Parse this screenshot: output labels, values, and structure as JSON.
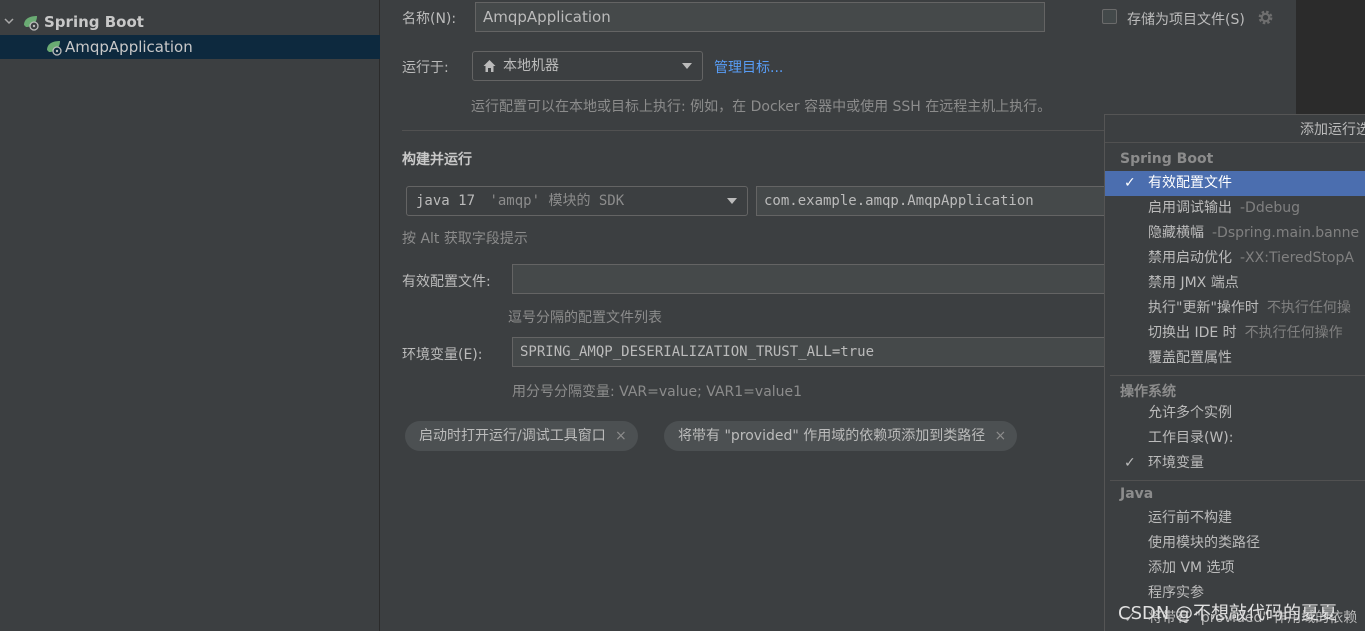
{
  "tree": {
    "items": [
      {
        "label": "Spring Boot",
        "bold": true
      },
      {
        "label": "AmqpApplication",
        "bold": false
      }
    ]
  },
  "form": {
    "name_label": "名称(N):",
    "name_value": "AmqpApplication",
    "store_as_file": "存储为项目文件(S)",
    "run_on_label": "运行于:",
    "run_on_value": "本地机器",
    "manage_targets": "管理目标...",
    "run_on_hint": "运行配置可以在本地或目标上执行: 例如，在 Docker 容器中或使用 SSH 在远程主机上执行。",
    "section_build_run": "构建并运行",
    "sdk_value": "java 17",
    "sdk_hint": "'amqp' 模块的 SDK",
    "main_class": "com.example.amqp.AmqpApplication",
    "alt_hint": "按 Alt 获取字段提示",
    "active_profiles_label": "有效配置文件:",
    "active_profiles_value": "",
    "profiles_hint": "逗号分隔的配置文件列表",
    "env_label": "环境变量(E):",
    "env_value": "SPRING_AMQP_DESERIALIZATION_TRUST_ALL=true",
    "env_hint": "用分号分隔变量: VAR=value; VAR1=value1",
    "chips": [
      "启动时打开运行/调试工具窗口",
      "将带有 \"provided\" 作用域的依赖项添加到类路径"
    ],
    "chip_close": "×"
  },
  "popup": {
    "title": "添加运行选",
    "groups": [
      {
        "name": "Spring Boot",
        "items": [
          {
            "label": "有效配置文件",
            "sub": "",
            "checked": true,
            "active": true
          },
          {
            "label": "启用调试输出",
            "sub": "-Ddebug",
            "checked": false,
            "active": false
          },
          {
            "label": "隐藏横幅",
            "sub": "-Dspring.main.banne",
            "checked": false,
            "active": false
          },
          {
            "label": "禁用启动优化",
            "sub": "-XX:TieredStopA",
            "checked": false,
            "active": false
          },
          {
            "label": "禁用 JMX 端点",
            "sub": "",
            "checked": false,
            "active": false
          },
          {
            "label": "执行\"更新\"操作时",
            "sub": "不执行任何操",
            "checked": false,
            "active": false
          },
          {
            "label": "切换出 IDE 时",
            "sub": "不执行任何操作",
            "checked": false,
            "active": false
          },
          {
            "label": "覆盖配置属性",
            "sub": "",
            "checked": false,
            "active": false
          }
        ]
      },
      {
        "name": "操作系统",
        "items": [
          {
            "label": "允许多个实例",
            "sub": "",
            "checked": false,
            "active": false
          },
          {
            "label": "工作目录(W):",
            "sub": "",
            "checked": false,
            "active": false
          },
          {
            "label": "环境变量",
            "sub": "",
            "checked": true,
            "active": false
          }
        ]
      },
      {
        "name": "Java",
        "items": [
          {
            "label": "运行前不构建",
            "sub": "",
            "checked": false,
            "active": false
          },
          {
            "label": "使用模块的类路径",
            "sub": "",
            "checked": false,
            "active": false
          },
          {
            "label": "添加 VM 选项",
            "sub": "",
            "checked": false,
            "active": false
          },
          {
            "label": "程序实参",
            "sub": "",
            "checked": false,
            "active": false
          },
          {
            "label": "将带有 \"provided\" 作用域的依赖",
            "sub": "",
            "checked": true,
            "active": false
          }
        ]
      }
    ],
    "check_glyph": "✓"
  },
  "watermark": "CSDN @不想敲代码的夏夏"
}
